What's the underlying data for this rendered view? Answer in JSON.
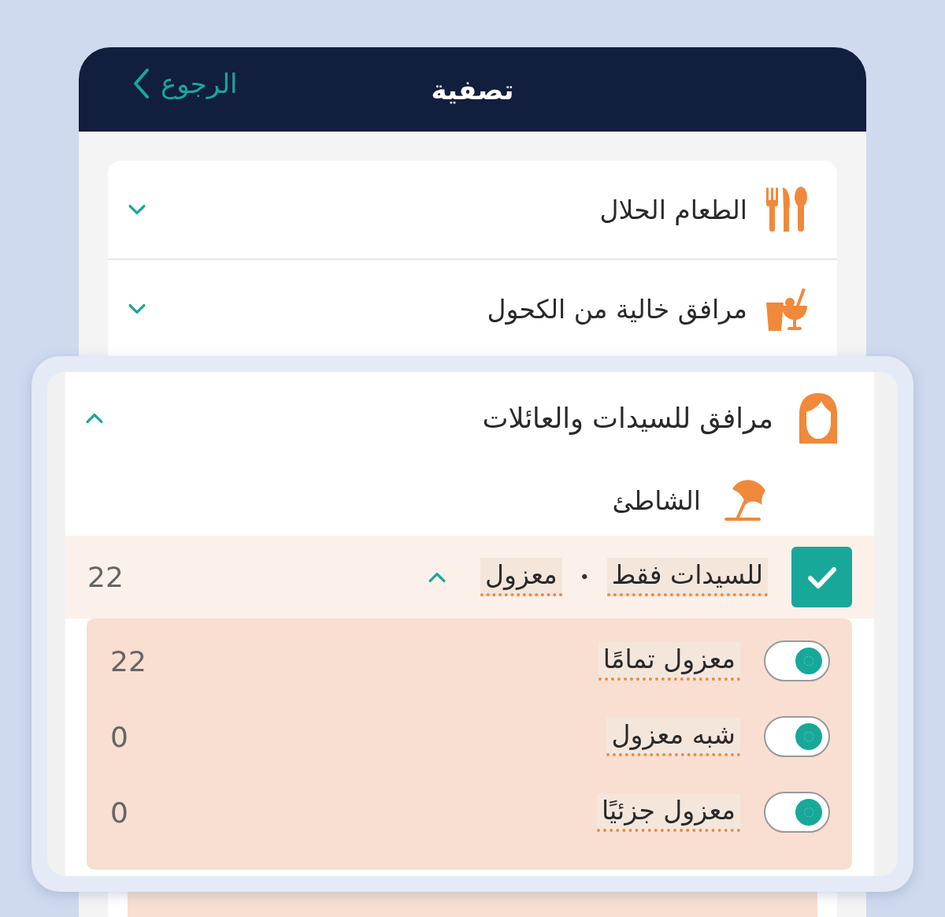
{
  "header": {
    "back_label": "الرجوع",
    "title": "تصفية"
  },
  "categories": [
    {
      "label": "الطعام الحلال",
      "expanded": false
    },
    {
      "label": "مرافق خالية من الكحول",
      "expanded": false
    }
  ],
  "magnifier": {
    "category": {
      "label": "مرافق للسيدات والعائلات",
      "expanded": true
    },
    "subcategory": {
      "label": "الشاطئ"
    },
    "option": {
      "checked": true,
      "tags": [
        "للسيدات فقط",
        "معزول"
      ],
      "separator": "•",
      "expanded": true,
      "count": "22"
    },
    "suboptions": [
      {
        "label": "معزول تمامًا",
        "on": true,
        "count": "22"
      },
      {
        "label": "شبه معزول",
        "on": true,
        "count": "0"
      },
      {
        "label": "معزول جزئيًا",
        "on": true,
        "count": "0"
      }
    ]
  }
}
